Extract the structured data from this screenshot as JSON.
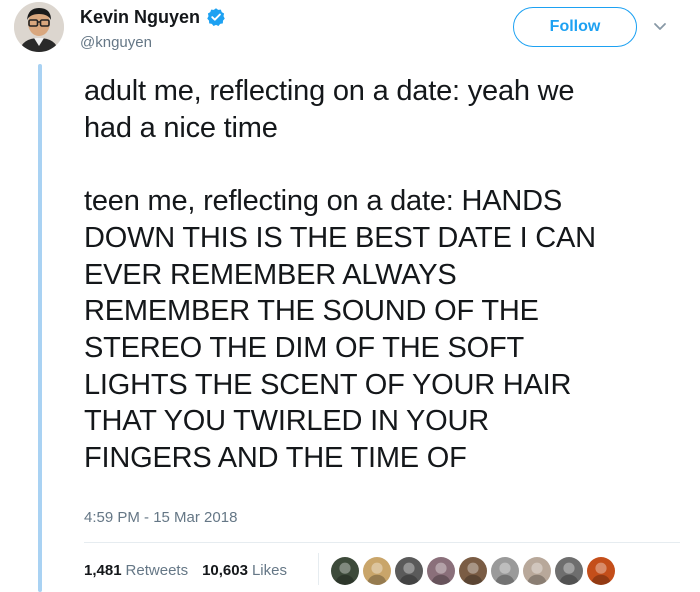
{
  "author": {
    "name": "Kevin Nguyen",
    "handle": "@knguyen",
    "verified_icon": "verified-badge-icon"
  },
  "actions": {
    "follow_label": "Follow",
    "menu_icon": "chevron-down-icon"
  },
  "tweet": {
    "text": "adult me, reflecting on a date: yeah we\nhad a nice time\n\nteen me, reflecting on a date: HANDS\nDOWN THIS IS THE BEST DATE I CAN\nEVER REMEMBER ALWAYS\nREMEMBER THE SOUND OF THE\nSTEREO THE DIM OF THE SOFT\nLIGHTS THE SCENT OF YOUR HAIR\nTHAT YOU TWIRLED IN YOUR\nFINGERS AND THE TIME OF",
    "timestamp": "4:59 PM - 15 Mar 2018"
  },
  "stats": {
    "retweets_count": "1,481",
    "retweets_label": "Retweets",
    "likes_count": "10,603",
    "likes_label": "Likes"
  },
  "likers": [
    {
      "name": "liker-avatar-1",
      "color": "#3d4a3a"
    },
    {
      "name": "liker-avatar-2",
      "color": "#c9a56a"
    },
    {
      "name": "liker-avatar-3",
      "color": "#5a5a5a"
    },
    {
      "name": "liker-avatar-4",
      "color": "#8a6f7a"
    },
    {
      "name": "liker-avatar-5",
      "color": "#7a5c44"
    },
    {
      "name": "liker-avatar-6",
      "color": "#9a9a9a"
    },
    {
      "name": "liker-avatar-7",
      "color": "#b8a89a"
    },
    {
      "name": "liker-avatar-8",
      "color": "#6e6e6e"
    },
    {
      "name": "liker-avatar-9",
      "color": "#c44e1a"
    }
  ],
  "colors": {
    "accent": "#1da1f2",
    "thread_line": "#a9d2f3",
    "secondary_text": "#657786"
  }
}
